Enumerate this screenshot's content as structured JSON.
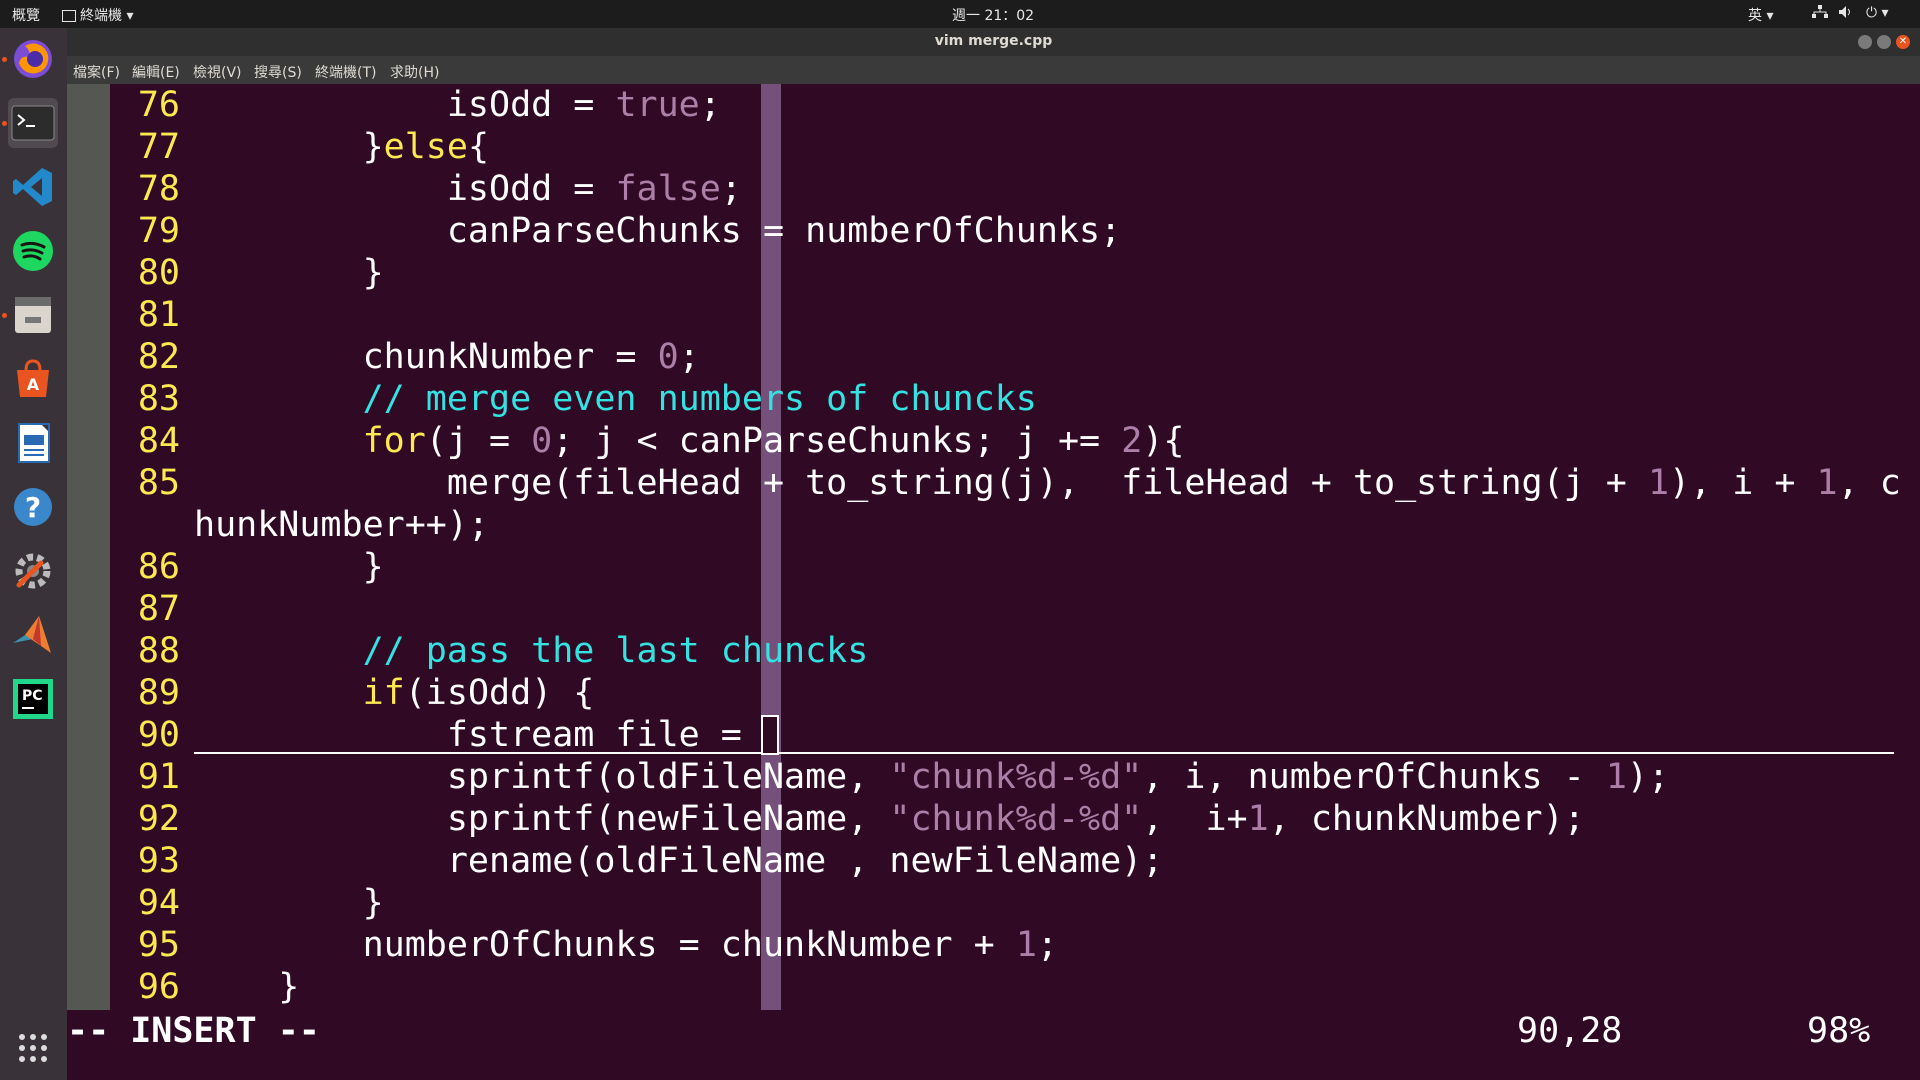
{
  "topbar": {
    "activities": "概覽",
    "app_menu": "終端機",
    "clock": "週一 21：02",
    "input_method": "英"
  },
  "dock": {
    "apps": [
      {
        "name": "firefox-icon"
      },
      {
        "name": "terminal-icon"
      },
      {
        "name": "vscode-icon"
      },
      {
        "name": "spotify-icon"
      },
      {
        "name": "files-icon"
      },
      {
        "name": "software-center-icon"
      },
      {
        "name": "libreoffice-writer-icon"
      },
      {
        "name": "help-icon"
      },
      {
        "name": "settings-icon"
      },
      {
        "name": "matlab-icon"
      },
      {
        "name": "pycharm-icon"
      }
    ],
    "show_apps": "show-applications-icon"
  },
  "window": {
    "title": "vim merge.cpp",
    "menu": [
      "檔案(F)",
      "編輯(E)",
      "檢視(V)",
      "搜尋(S)",
      "終端機(T)",
      "求助(H)"
    ]
  },
  "editor": {
    "lines": [
      {
        "n": "76",
        "segs": [
          [
            "            isOdd = ",
            ""
          ],
          [
            "true",
            "num"
          ],
          [
            ";",
            ""
          ]
        ]
      },
      {
        "n": "77",
        "segs": [
          [
            "        }",
            ""
          ],
          [
            "else",
            "kw"
          ],
          [
            "{",
            ""
          ]
        ]
      },
      {
        "n": "78",
        "segs": [
          [
            "            isOdd = ",
            ""
          ],
          [
            "false",
            "num"
          ],
          [
            ";",
            ""
          ]
        ]
      },
      {
        "n": "79",
        "segs": [
          [
            "            canParseChunks = numberOfChunks;",
            ""
          ]
        ]
      },
      {
        "n": "80",
        "segs": [
          [
            "        }",
            ""
          ]
        ]
      },
      {
        "n": "81",
        "segs": []
      },
      {
        "n": "82",
        "segs": [
          [
            "        chunkNumber = ",
            ""
          ],
          [
            "0",
            "num"
          ],
          [
            ";",
            ""
          ]
        ]
      },
      {
        "n": "83",
        "segs": [
          [
            "        // merge even numbers of chuncks",
            "cmt"
          ]
        ]
      },
      {
        "n": "84",
        "segs": [
          [
            "        ",
            ""
          ],
          [
            "for",
            "kw"
          ],
          [
            "(j = ",
            ""
          ],
          [
            "0",
            "num"
          ],
          [
            "; j < canParseChunks; j += ",
            ""
          ],
          [
            "2",
            "num"
          ],
          [
            "){",
            ""
          ]
        ]
      },
      {
        "n": "85",
        "segs": [
          [
            "            merge(fileHead + to_string(j),  fileHead + to_string(j + ",
            ""
          ],
          [
            "1",
            "num"
          ],
          [
            "), i + ",
            ""
          ],
          [
            "1",
            "num"
          ],
          [
            ", c",
            ""
          ]
        ]
      },
      {
        "n": "",
        "segs": [
          [
            "hunkNumber++);",
            ""
          ]
        ]
      },
      {
        "n": "86",
        "segs": [
          [
            "        }",
            ""
          ]
        ]
      },
      {
        "n": "87",
        "segs": []
      },
      {
        "n": "88",
        "segs": [
          [
            "        // pass the last chuncks",
            "cmt"
          ]
        ]
      },
      {
        "n": "89",
        "segs": [
          [
            "        ",
            ""
          ],
          [
            "if",
            "kw"
          ],
          [
            "(isOdd) {",
            ""
          ]
        ]
      },
      {
        "n": "90",
        "segs": [
          [
            "            fstream file = ",
            ""
          ]
        ]
      },
      {
        "n": "91",
        "segs": [
          [
            "            sprintf(oldFileName, ",
            ""
          ],
          [
            "\"chunk%d-%d\"",
            "str"
          ],
          [
            ", i, numberOfChunks - ",
            ""
          ],
          [
            "1",
            "num"
          ],
          [
            ");",
            ""
          ]
        ]
      },
      {
        "n": "92",
        "segs": [
          [
            "            sprintf(newFileName, ",
            ""
          ],
          [
            "\"chunk%d-%d\"",
            "str"
          ],
          [
            ",  i+",
            ""
          ],
          [
            "1",
            "num"
          ],
          [
            ", chunkNumber);",
            ""
          ]
        ]
      },
      {
        "n": "93",
        "segs": [
          [
            "            rename(oldFileName , newFileName);",
            ""
          ]
        ]
      },
      {
        "n": "94",
        "segs": [
          [
            "        }",
            ""
          ]
        ]
      },
      {
        "n": "95",
        "segs": [
          [
            "        numberOfChunks = chunkNumber + ",
            ""
          ],
          [
            "1",
            "num"
          ],
          [
            ";",
            ""
          ]
        ]
      },
      {
        "n": "96",
        "segs": [
          [
            "    }",
            ""
          ]
        ]
      }
    ],
    "mode": "-- INSERT --",
    "cursor_position": "90,28",
    "scroll_percent": "98%"
  }
}
